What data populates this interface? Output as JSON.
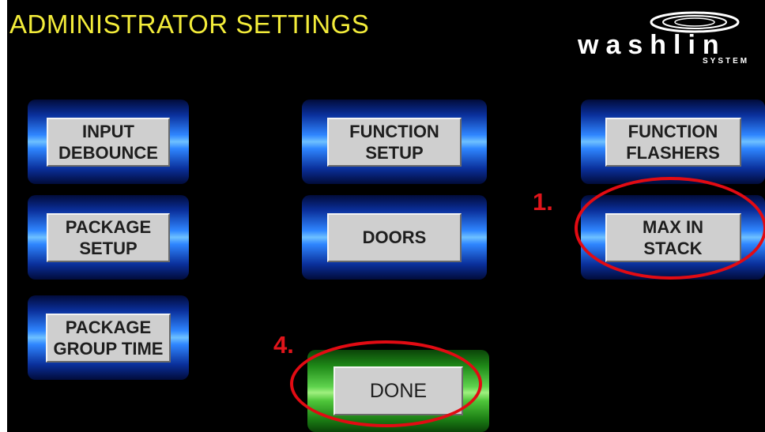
{
  "header": {
    "title": "ADMINISTRATOR SETTINGS",
    "logo_text": "washlin",
    "logo_sub": "SYSTEM"
  },
  "buttons": {
    "input_debounce": "INPUT\nDEBOUNCE",
    "function_setup": "FUNCTION\nSETUP",
    "function_flashers": "FUNCTION\nFLASHERS",
    "package_setup": "PACKAGE\nSETUP",
    "doors": "DOORS",
    "max_in_stack": "MAX IN\nSTACK",
    "package_group_time": "PACKAGE\nGROUP TIME",
    "done": "DONE"
  },
  "annotations": {
    "step1": "1.",
    "step4": "4."
  },
  "colors": {
    "title": "#f3ec3a",
    "highlight_ring": "#e20b13",
    "marker": "#e0151b"
  }
}
